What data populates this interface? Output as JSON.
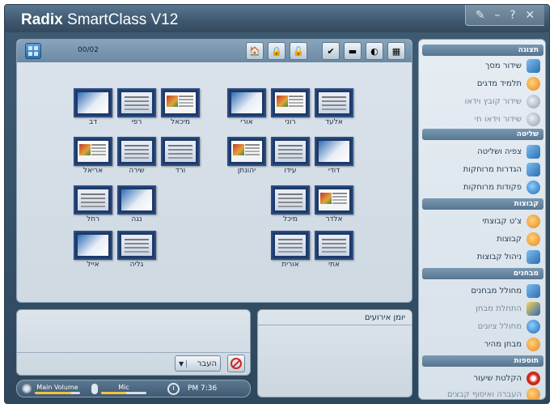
{
  "app": {
    "title_bold": "Radix",
    "title_rest": " SmartClass V12",
    "controls": {
      "tools": "✎",
      "minimize": "–",
      "help": "?",
      "close": "✕"
    }
  },
  "toolbar": {
    "page_count": "00/02",
    "icons": [
      "lock-house-icon",
      "lock-screen-icon",
      "unlock-icon",
      "attendance-icon",
      "black-screen-icon",
      "hide-icon",
      "window-icon"
    ]
  },
  "students": {
    "s1": "אלעד",
    "s2": "רוני",
    "s3": "אורי",
    "s4": "מיכאל",
    "s5": "רפי",
    "s6": "דב",
    "s7": "דודי",
    "s8": "עידו",
    "s9": "יהונתן",
    "s10": "ורד",
    "s11": "שירה",
    "s12": "אריאל",
    "s13": "אלדר",
    "s14": "מיכל",
    "s15": "נגה",
    "s16": "רחל",
    "s17": "אתי",
    "s18": "אורית",
    "s19": "גליה",
    "s20": "אייל"
  },
  "chat": {
    "send_label": "העבר",
    "send_arrow": "▼"
  },
  "volume": {
    "main_label": "Main Volume",
    "main_level": 0.8,
    "mic_label": "Mic",
    "mic_level": 0.55,
    "time": "PM 7:36"
  },
  "log": {
    "title": "יומן אירועים"
  },
  "sidebar": {
    "display_header": "תצוגה",
    "screen_broadcast": "שידור מסך",
    "demo_student": "תלמיד מדגים",
    "video_file_broadcast": "שידור קובץ וידאו",
    "live_video_broadcast": "שידור וידאו חי",
    "control_header": "שליטה",
    "view_control": "צפיה ושליטה",
    "remote_settings": "הגדרות מרוחקות",
    "remote_commands": "פקודות מרוחקות",
    "groups_header": "קבוצות",
    "group_chat": "צ'ט קבוצתי",
    "groups": "קבוצות",
    "group_management": "ניהול קבוצות",
    "tests_header": "מבחנים",
    "test_generator": "מחולל מבחנים",
    "start_test": "התחלת מבחן",
    "grade_generator": "מחולל ציונים",
    "quick_test": "מבחן מהיר",
    "extras_header": "תוספות",
    "lesson_recording": "הקלטת שיעור",
    "file_transfer": "העברה ואיסוף קבצים"
  },
  "colors": {
    "frame": "#3f5b73",
    "panel": "#dbe4ec",
    "accent": "#f3c23d",
    "section_header": "#6a89a3"
  }
}
